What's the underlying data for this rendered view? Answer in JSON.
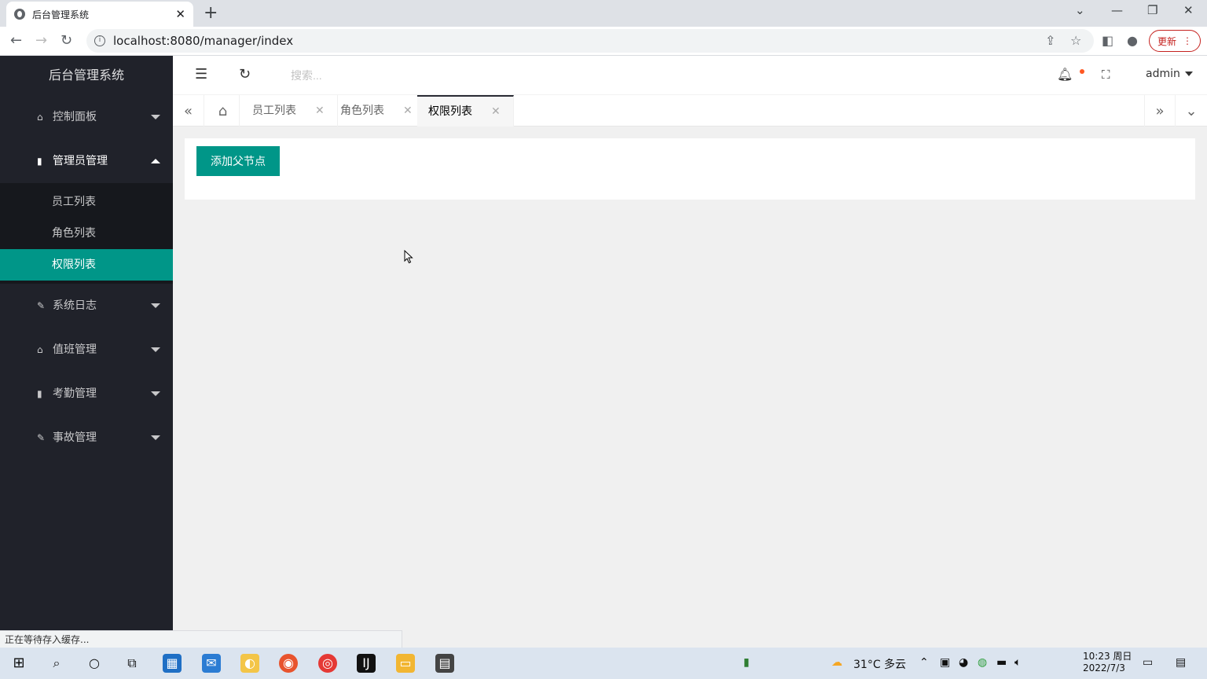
{
  "browser": {
    "tab_title": "后台管理系统",
    "url": "localhost:8080/manager/index",
    "update_label": "更新",
    "status_text": "正在等待存入缓存..."
  },
  "app": {
    "logo": "后台管理系统",
    "accent_color": "#009688",
    "sidebar": {
      "items": [
        {
          "label": "控制面板",
          "icon": "home-icon",
          "state": "collapsed"
        },
        {
          "label": "管理员管理",
          "icon": "book-icon",
          "state": "expanded",
          "children": [
            {
              "label": "员工列表"
            },
            {
              "label": "角色列表"
            },
            {
              "label": "权限列表",
              "active": true
            }
          ]
        },
        {
          "label": "系统日志",
          "icon": "pencil-icon",
          "state": "collapsed"
        },
        {
          "label": "值班管理",
          "icon": "home-icon",
          "state": "collapsed"
        },
        {
          "label": "考勤管理",
          "icon": "book-icon",
          "state": "collapsed"
        },
        {
          "label": "事故管理",
          "icon": "pencil-icon",
          "state": "collapsed"
        }
      ]
    },
    "header": {
      "search_placeholder": "搜索...",
      "user": "admin"
    },
    "tabs": [
      {
        "label": "员工列表"
      },
      {
        "label": "角色列表"
      },
      {
        "label": "权限列表",
        "active": true
      }
    ],
    "content": {
      "add_button": "添加父节点"
    }
  },
  "taskbar": {
    "weather": "31°C 多云",
    "time": "10:23 周日",
    "date": "2022/7/3"
  }
}
